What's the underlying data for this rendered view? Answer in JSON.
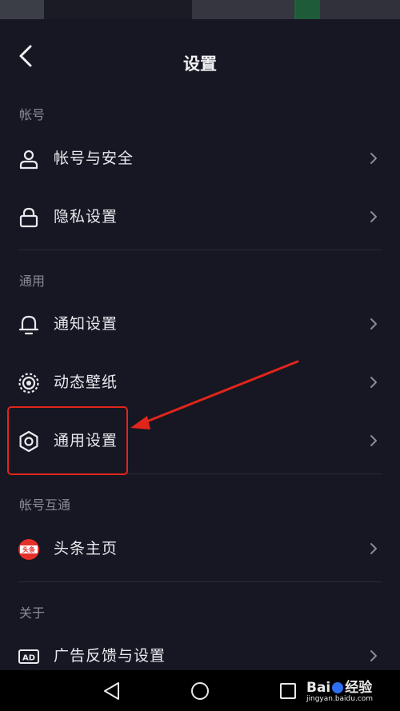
{
  "header": {
    "title": "设置"
  },
  "sections": {
    "account": "帐号",
    "general": "通用",
    "interconnect": "帐号互通",
    "about": "关于"
  },
  "rows": {
    "account_security": "帐号与安全",
    "privacy": "隐私设置",
    "notifications": "通知设置",
    "wallpaper": "动态壁纸",
    "general_settings": "通用设置",
    "toutiao": "头条主页",
    "ads": "广告反馈与设置"
  },
  "icons": {
    "toutiao_badge": "头条",
    "ad_badge": "AD"
  },
  "colors": {
    "background": "#161722",
    "highlight": "#e1251b",
    "toutiao": "#e6302c"
  },
  "watermark": {
    "brand": "Bai",
    "suffix": "经验",
    "url": "jingyan.baidu.com"
  }
}
